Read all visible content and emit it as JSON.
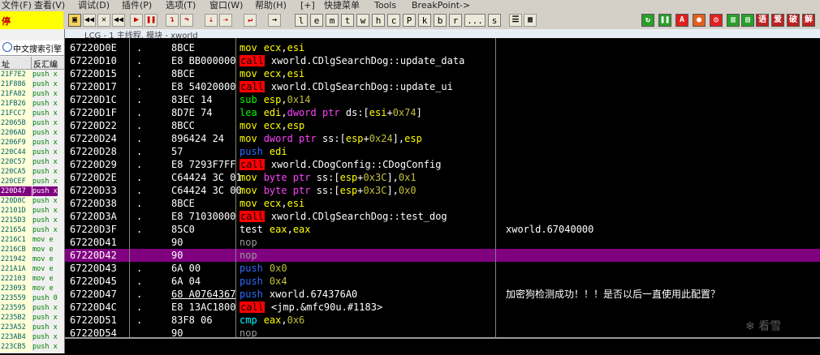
{
  "menubar": {
    "items": [
      "文件(F)",
      "查看(V)",
      "调试(D)",
      "插件(P)",
      "选项(T)",
      "窗口(W)",
      "帮助(H)",
      "[+]",
      "快捷菜单",
      "Tools",
      "BreakPoint->"
    ]
  },
  "status_box": {
    "label": "停"
  },
  "toolbar": {
    "letter_buttons": [
      "l",
      "e",
      "m",
      "t",
      "w",
      "h",
      "c",
      "P",
      "k",
      "b",
      "r",
      "...",
      "s"
    ],
    "right_icons": [
      "A",
      "语",
      "爱",
      "破",
      "解"
    ]
  },
  "left_panel": {
    "search_label": "中文搜索引擎",
    "col_addr": "址",
    "col_disasm": "反汇编",
    "rows": [
      {
        "addr": "21F7E2",
        "text": "push x"
      },
      {
        "addr": "21F886",
        "text": "push x"
      },
      {
        "addr": "21FA82",
        "text": "push x"
      },
      {
        "addr": "21FB26",
        "text": "push x"
      },
      {
        "addr": "21FCC7",
        "text": "push x"
      },
      {
        "addr": "22065B",
        "text": "push x"
      },
      {
        "addr": "2206AD",
        "text": "push x"
      },
      {
        "addr": "2206F9",
        "text": "push x"
      },
      {
        "addr": "220C44",
        "text": "push x"
      },
      {
        "addr": "220C57",
        "text": "push x"
      },
      {
        "addr": "220CA5",
        "text": "push x"
      },
      {
        "addr": "220CEF",
        "text": "push x"
      },
      {
        "addr": "220D47",
        "text": "push x",
        "selected": true
      },
      {
        "addr": "220D8C",
        "text": "push x"
      },
      {
        "addr": "22101D",
        "text": "push x"
      },
      {
        "addr": "2215D3",
        "text": "push x"
      },
      {
        "addr": "221654",
        "text": "push x"
      },
      {
        "addr": "2216C1",
        "text": "mov e"
      },
      {
        "addr": "2216CB",
        "text": "mov e"
      },
      {
        "addr": "221942",
        "text": "mov e"
      },
      {
        "addr": "221A1A",
        "text": "mov e"
      },
      {
        "addr": "222103",
        "text": "mov e"
      },
      {
        "addr": "223093",
        "text": "mov e"
      },
      {
        "addr": "223559",
        "text": "push 0"
      },
      {
        "addr": "223595",
        "text": "push x"
      },
      {
        "addr": "2235B2",
        "text": "push x"
      },
      {
        "addr": "223A52",
        "text": "push x"
      },
      {
        "addr": "223AB4",
        "text": "push x"
      },
      {
        "addr": "223CB5",
        "text": "push x"
      }
    ]
  },
  "window": {
    "title": "LCG - 1 主线程, 模块 - xworld"
  },
  "disasm": {
    "rows": [
      {
        "addr": "67220D0E",
        "mark": ".",
        "hex": "8BCE",
        "op": "mov",
        "args": "ecx,esi",
        "comment": ""
      },
      {
        "addr": "67220D10",
        "mark": ".",
        "hex": "E8 BB000000",
        "op": "call",
        "args": "xworld.CDlgSearchDog::update_data",
        "comment": ""
      },
      {
        "addr": "67220D15",
        "mark": ".",
        "hex": "8BCE",
        "op": "mov",
        "args": "ecx,esi",
        "comment": ""
      },
      {
        "addr": "67220D17",
        "mark": ".",
        "hex": "E8 54020000",
        "op": "call",
        "args": "xworld.CDlgSearchDog::update_ui",
        "comment": ""
      },
      {
        "addr": "67220D1C",
        "mark": ".",
        "hex": "83EC 14",
        "op": "sub",
        "args": "esp,0x14",
        "comment": ""
      },
      {
        "addr": "67220D1F",
        "mark": ".",
        "hex": "8D7E 74",
        "op": "lea",
        "args": "edi,dword ptr ds:[esi+0x74]",
        "comment": ""
      },
      {
        "addr": "67220D22",
        "mark": ".",
        "hex": "8BCC",
        "op": "mov",
        "args": "ecx,esp",
        "comment": ""
      },
      {
        "addr": "67220D24",
        "mark": ".",
        "hex": "896424 24",
        "op": "mov",
        "args": "dword ptr ss:[esp+0x24],esp",
        "comment": ""
      },
      {
        "addr": "67220D28",
        "mark": ".",
        "hex": "57",
        "op": "push",
        "args": "edi",
        "comment": ""
      },
      {
        "addr": "67220D29",
        "mark": ".",
        "hex": "E8 7293F7FF",
        "op": "call",
        "args": "xworld.CDogConfig::CDogConfig",
        "comment": ""
      },
      {
        "addr": "67220D2E",
        "mark": ".",
        "hex": "C64424 3C 01",
        "op": "mov",
        "args": "byte ptr ss:[esp+0x3C],0x1",
        "comment": ""
      },
      {
        "addr": "67220D33",
        "mark": ".",
        "hex": "C64424 3C 00",
        "op": "mov",
        "args": "byte ptr ss:[esp+0x3C],0x0",
        "comment": ""
      },
      {
        "addr": "67220D38",
        "mark": ".",
        "hex": "8BCE",
        "op": "mov",
        "args": "ecx,esi",
        "comment": ""
      },
      {
        "addr": "67220D3A",
        "mark": ".",
        "hex": "E8 71030000",
        "op": "call",
        "args": "xworld.CDlgSearchDog::test_dog",
        "comment": ""
      },
      {
        "addr": "67220D3F",
        "mark": ".",
        "hex": "85C0",
        "op": "test",
        "args": "eax,eax",
        "comment": "xworld.67040000"
      },
      {
        "addr": "67220D41",
        "mark": "",
        "hex": "90",
        "op": "nop",
        "args": "",
        "comment": ""
      },
      {
        "addr": "67220D42",
        "mark": "",
        "hex": "90",
        "op": "nop",
        "args": "",
        "comment": "",
        "highlight": true
      },
      {
        "addr": "67220D43",
        "mark": ".",
        "hex": "6A 00",
        "op": "push",
        "args": "0x0",
        "comment": ""
      },
      {
        "addr": "67220D45",
        "mark": ".",
        "hex": "6A 04",
        "op": "push",
        "args": "0x4",
        "comment": ""
      },
      {
        "addr": "67220D47",
        "mark": ".",
        "hex": "68 A0764367",
        "op": "push",
        "args": "xworld.674376A0",
        "comment": "加密狗检测成功！！！是否以后一直使用此配置？"
      },
      {
        "addr": "67220D4C",
        "mark": ".",
        "hex": "E8 13AC1800",
        "op": "call",
        "args": "<jmp.&mfc90u.#1183>",
        "comment": ""
      },
      {
        "addr": "67220D51",
        "mark": ".",
        "hex": "83F8 06",
        "op": "cmp",
        "args": "eax,0x6",
        "comment": ""
      },
      {
        "addr": "67220D54",
        "mark": "",
        "hex": "90",
        "op": "nop",
        "args": "",
        "comment": ""
      }
    ]
  },
  "watermark": "看雪",
  "colors": {
    "call": "#ff0000",
    "mov": "#ffff00",
    "push": "#2f6bff",
    "highlight": "#800080"
  }
}
